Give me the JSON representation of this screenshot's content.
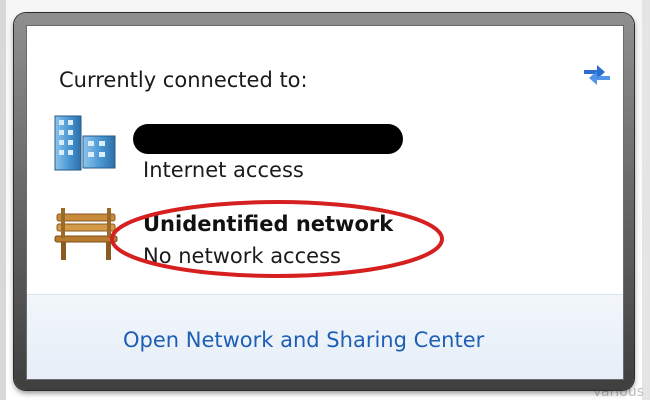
{
  "popup": {
    "heading": "Currently connected to:"
  },
  "networks": [
    {
      "name": "",
      "name_redacted": true,
      "status": "Internet access",
      "icon": "network-building-icon"
    },
    {
      "name": "Unidentified network",
      "name_redacted": false,
      "status": "No network access",
      "icon": "park-bench-icon",
      "highlight_color": "#d6201f"
    }
  ],
  "footer": {
    "link_label": "Open Network and Sharing Center"
  },
  "background": {
    "corner_text": "Various"
  },
  "colors": {
    "link": "#1e5fb5",
    "annotation": "#d6201f",
    "footer_bg": "#e6eef8"
  }
}
